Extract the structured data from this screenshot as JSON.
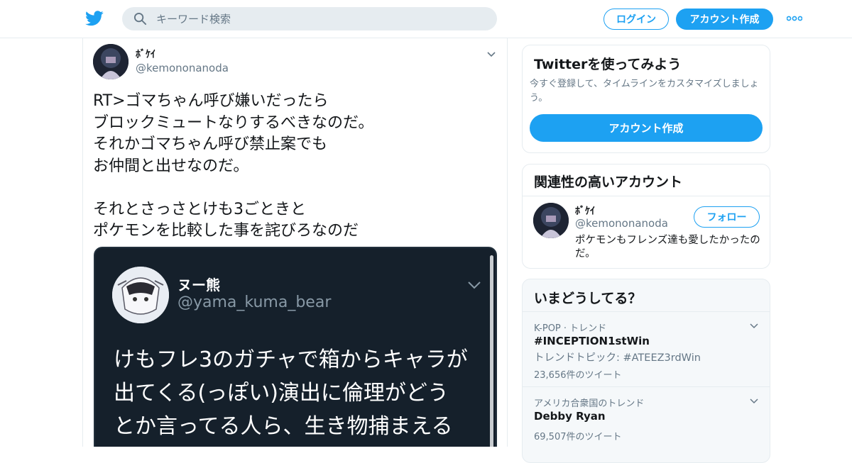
{
  "header": {
    "search_placeholder": "キーワード検索",
    "login_label": "ログイン",
    "signup_label": "アカウント作成"
  },
  "tweet": {
    "name": "ﾎﾞｹｲ",
    "handle": "@kemononanoda",
    "lines": [
      "RT>ゴマちゃん呼び嫌いだったら",
      "ブロックミュートなりするべきなのだ。",
      "それかゴマちゃん呼び禁止案でも",
      "お仲間と出せなのだ。",
      "",
      "それとさっさとけも3ごときと",
      "ポケモンを比較した事を詫びろなのだ"
    ],
    "media": {
      "name": "ヌー熊",
      "handle": "@yama_kuma_bear",
      "lines": [
        "けもフレ3のガチャで箱からキャラが",
        "出てくる(っぽい)演出に倫理がどう",
        "とか言ってる人ら、生き物捕まえる"
      ]
    }
  },
  "sidebar": {
    "signup_card": {
      "title": "Twitterを使ってみよう",
      "description": "今すぐ登録して、タイムラインをカスタマイズしましょう。",
      "button": "アカウント作成"
    },
    "related": {
      "title": "関連性の高いアカウント",
      "name": "ﾎﾞｹｲ",
      "handle": "@kemononanoda",
      "bio": "ポケモンもフレンズ達も愛したかったのだ。",
      "follow_label": "フォロー"
    },
    "trends": {
      "title": "いまどうしてる？",
      "items": [
        {
          "context": "K-POP · トレンド",
          "name": "#INCEPTION1stWin",
          "subtitle": "トレンドトピック: #ATEEZ3rdWin",
          "count": "23,656件のツイート"
        },
        {
          "context": "アメリカ合衆国のトレンド",
          "name": "Debby Ryan",
          "count": "69,507件のツイート"
        }
      ]
    }
  },
  "colors": {
    "brand": "#1da1f2",
    "text": "#14171a",
    "secondary": "#657786",
    "border": "#e6ecf0"
  }
}
